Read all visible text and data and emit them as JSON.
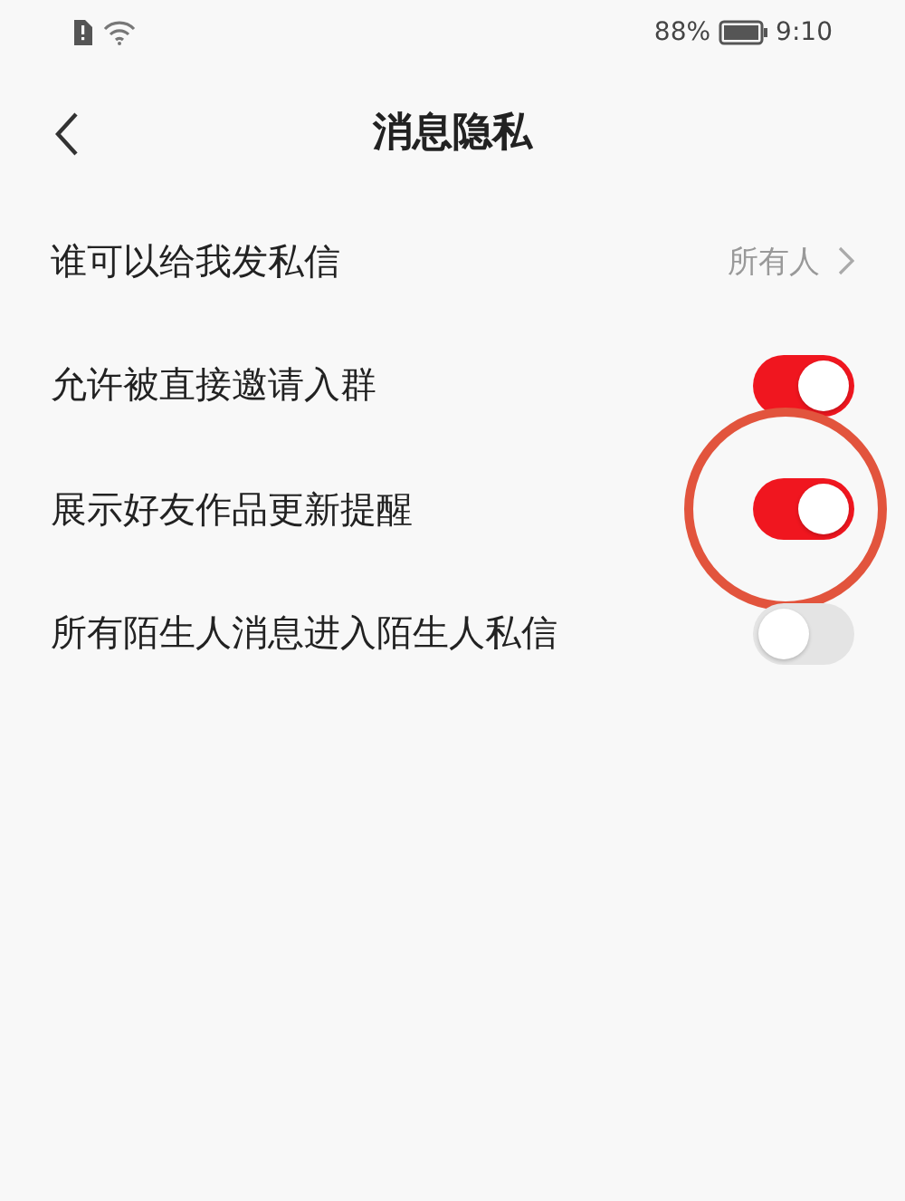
{
  "status_bar": {
    "battery_text": "88%",
    "time": "9:10"
  },
  "header": {
    "title": "消息隐私"
  },
  "settings": [
    {
      "kind": "link",
      "label": "谁可以给我发私信",
      "value": "所有人",
      "highlighted": false
    },
    {
      "kind": "toggle",
      "label": "允许被直接邀请入群",
      "on": true,
      "highlighted": false
    },
    {
      "kind": "toggle",
      "label": "展示好友作品更新提醒",
      "on": true,
      "highlighted": true
    },
    {
      "kind": "toggle",
      "label": "所有陌生人消息进入陌生人私信",
      "on": false,
      "highlighted": false
    }
  ]
}
